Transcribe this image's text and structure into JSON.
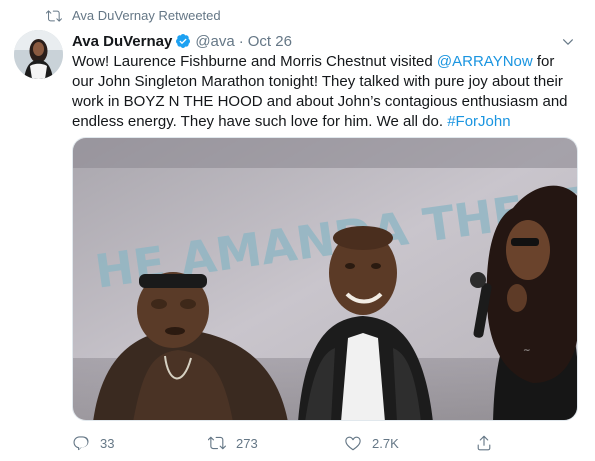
{
  "retweet": {
    "text": "Ava DuVernay Retweeted",
    "icon": "retweet-icon"
  },
  "tweet": {
    "author": {
      "display_name": "Ava DuVernay",
      "handle": "@ava",
      "verified": true
    },
    "separator": "·",
    "date": "Oct 26",
    "text": {
      "p1": "Wow! Laurence Fishburne and Morris Chestnut visited ",
      "mention": "@ARRAYNow",
      "p2": " for our John Singleton Marathon tonight! They talked with pure joy about their work in BOYZ N THE HOOD and about John’s contagious enthusiasm and endless energy. They have such love for him. We all do. ",
      "hashtag": "#ForJohn"
    },
    "media": {
      "alt": "Photo of Laurence Fishburne, Morris Chestnut and Ava DuVernay on stage at the Amanda Theater",
      "sign_text": "HE AMANDA THEATE"
    },
    "actions": {
      "reply": {
        "icon": "reply-icon",
        "count": "33"
      },
      "retweet": {
        "icon": "retweet-icon",
        "count": "273"
      },
      "like": {
        "icon": "heart-icon",
        "count": "2.7K"
      },
      "share": {
        "icon": "share-icon"
      }
    }
  },
  "colors": {
    "link": "#1b95e0",
    "muted": "#657786",
    "text": "#14171a",
    "verified": "#1da1f2"
  }
}
